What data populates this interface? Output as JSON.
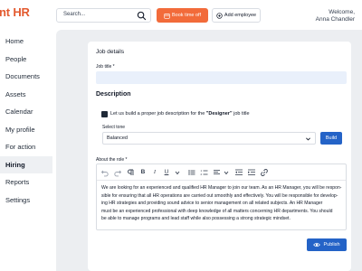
{
  "logo": {
    "prefix": "ent ",
    "suffix": "HR"
  },
  "header": {
    "search_placeholder": "Search...",
    "book_time_off": "Book time off",
    "add_employee": "Add employee",
    "welcome": "Welcome,",
    "user_name": "Anna Chandler"
  },
  "sidebar": {
    "items": [
      {
        "label": "Home"
      },
      {
        "label": "People"
      },
      {
        "label": "Documents"
      },
      {
        "label": "Assets"
      },
      {
        "label": "Calendar"
      },
      {
        "label": "My profile"
      },
      {
        "label": "For action"
      },
      {
        "label": "Hiring",
        "active": true
      },
      {
        "label": "Reports"
      },
      {
        "label": "Settings"
      }
    ]
  },
  "form": {
    "job_details_title": "Job details",
    "job_title_label": "Job title *",
    "job_title_value": "",
    "description_title": "Description",
    "ai_check_prefix": "Let us build a proper job description for the ",
    "ai_check_job": "\"Designer\"",
    "ai_check_suffix": " job title",
    "tone_label": "Select tone",
    "tone_value": "Balanced",
    "build_label": "Build",
    "about_label": "About the role *",
    "about_lines": [
      "We are looking for an experienced and qualified HR Manager to join our team. As an HR Manager, you will be respon-",
      "sible for ensuring that all HR operations are carried out smoothly and effectively. You will be responsible for develop-",
      "ing HR strategies and providing sound advice to senior management on all related subjects. An HR Manager",
      "must be an experienced professional with deep knowledge of all matters concerning HR departments. You should",
      "be able to manage programs and lead staff while also possessing a strong strategic mindset."
    ],
    "publish_label": "Publish"
  },
  "colors": {
    "brand": "#e35a2f",
    "orange_button": "#f26b3a",
    "primary_blue": "#2463c7",
    "main_bg": "#eceef1"
  }
}
